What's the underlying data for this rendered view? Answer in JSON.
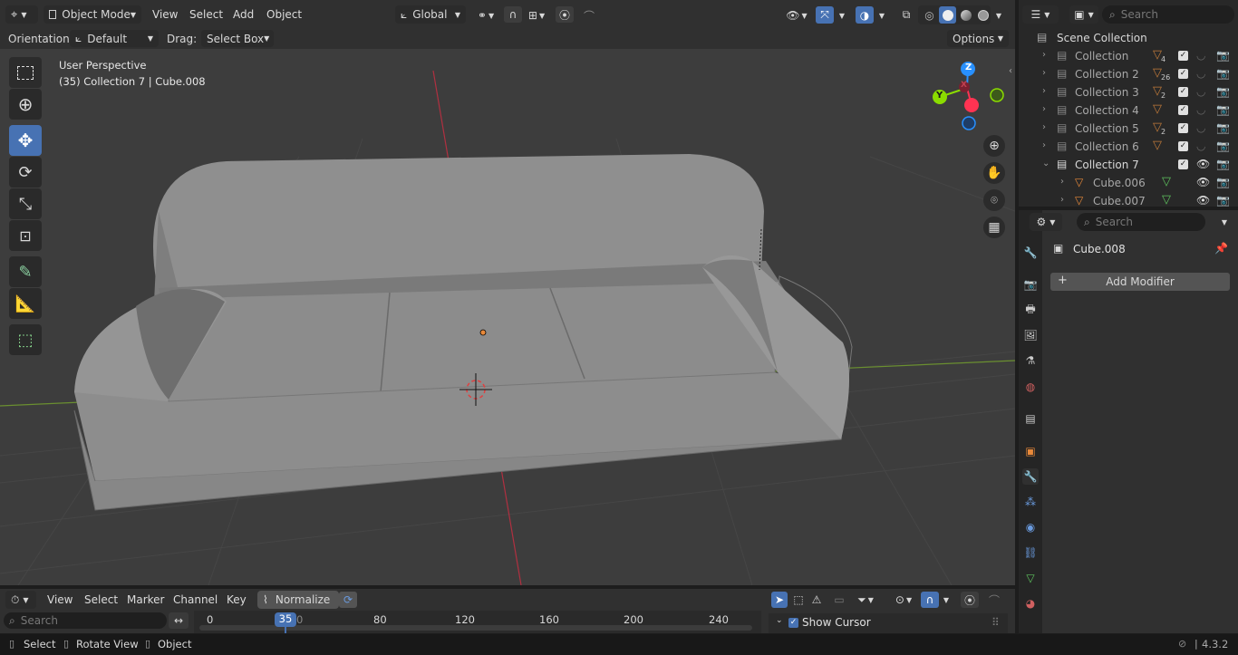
{
  "header": {
    "mode": "Object Mode",
    "menus": [
      "View",
      "Select",
      "Add",
      "Object"
    ],
    "transform_orientation": "Global",
    "orientation_label": "Orientation:",
    "orientation_value": "Default",
    "drag_label": "Drag:",
    "drag_value": "Select Box",
    "options": "Options"
  },
  "viewport": {
    "view_name": "User Perspective",
    "context": "(35) Collection 7 | Cube.008",
    "gizmo": {
      "z": "Z",
      "y": "Y",
      "x": "X"
    }
  },
  "outliner": {
    "search_placeholder": "Search",
    "root": "Scene Collection",
    "rows": [
      {
        "label": "Collection",
        "count": "4"
      },
      {
        "label": "Collection 2",
        "count": "26"
      },
      {
        "label": "Collection 3",
        "count": "2"
      },
      {
        "label": "Collection 4",
        "count": ""
      },
      {
        "label": "Collection 5",
        "count": "2"
      },
      {
        "label": "Collection 6",
        "count": ""
      },
      {
        "label": "Collection 7",
        "count": ""
      },
      {
        "label": "Cube.006",
        "count": ""
      },
      {
        "label": "Cube.007",
        "count": ""
      }
    ]
  },
  "properties": {
    "search_placeholder": "Search",
    "object_name": "Cube.008",
    "add_modifier": "Add Modifier"
  },
  "timeline": {
    "menus": [
      "View",
      "Select",
      "Marker",
      "Channel",
      "Key"
    ],
    "normalize": "Normalize",
    "search_placeholder": "Search",
    "current_frame": "35",
    "ticks": [
      "0",
      "80",
      "120",
      "160",
      "200",
      "240"
    ],
    "partial_tick": "0",
    "show_cursor": "Show Cursor"
  },
  "statusbar": {
    "select": "Select",
    "rotate_view": "Rotate View",
    "object": "Object",
    "version": "4.3.2"
  },
  "colors": {
    "accent": "#4772b3",
    "x_axis": "#ff3352",
    "y_axis": "#8bdc00",
    "z_axis": "#2890ff",
    "object_orange": "#e8893a"
  }
}
